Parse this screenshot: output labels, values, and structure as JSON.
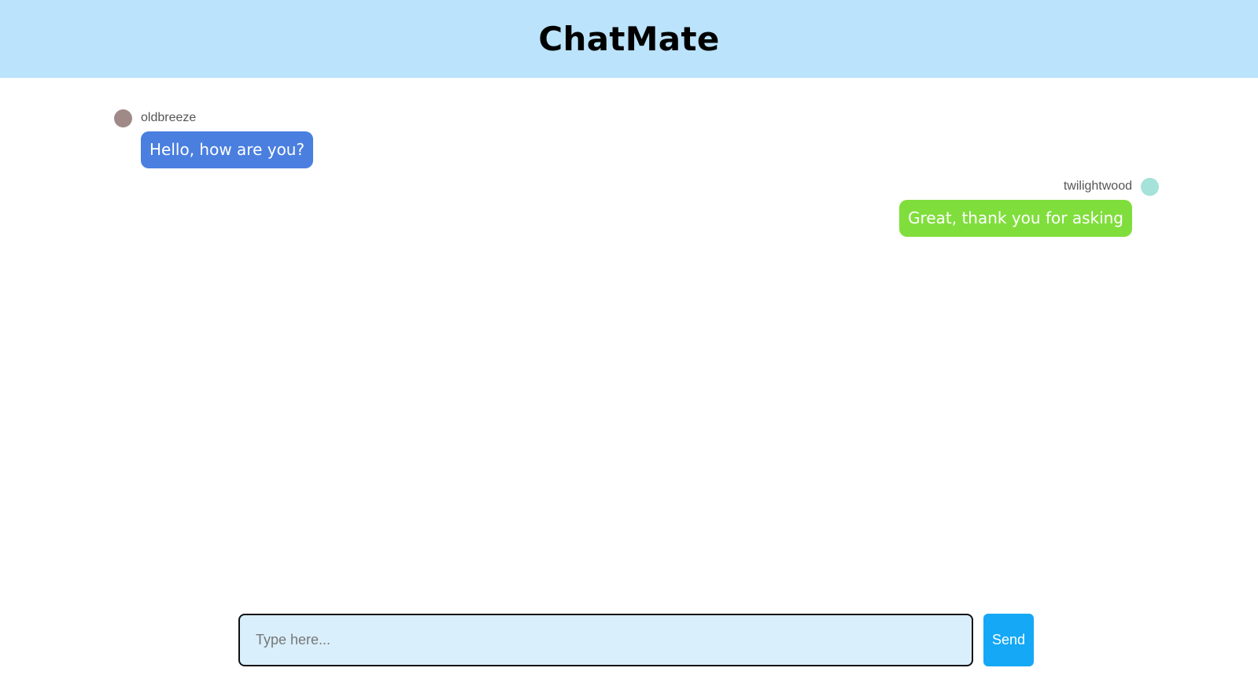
{
  "app": {
    "title": "ChatMate",
    "header_color": "#bbe3fb"
  },
  "messages": [
    {
      "username": "oldbreeze",
      "text": "Hello, how are you?",
      "side": "left",
      "avatar_color": "#a08a88",
      "bubble_color": "#4a7fe0"
    },
    {
      "username": "twilightwood",
      "text": "Great, thank you for asking",
      "side": "right",
      "avatar_color": "#a5e2d8",
      "bubble_color": "#80de3c"
    }
  ],
  "composer": {
    "placeholder": "Type here...",
    "value": "",
    "send_label": "Send",
    "send_color": "#14a8f6"
  }
}
